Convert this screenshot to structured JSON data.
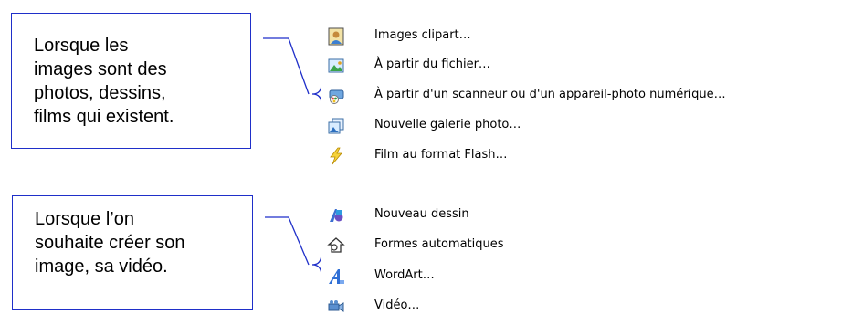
{
  "callouts": {
    "first": [
      "Lorsque les",
      "images sont des",
      "photos, dessins,",
      "films qui existent."
    ],
    "second": [
      "Lorsque l’on",
      "souhaite créer son",
      "image, sa vidéo."
    ]
  },
  "menu": {
    "group1": [
      {
        "label": "Images clipart…",
        "icon": "clipart-icon"
      },
      {
        "label": "À partir du fichier…",
        "icon": "picture-from-file-icon"
      },
      {
        "label": "À partir d'un scanneur ou d'un appareil-photo numérique…",
        "icon": "scanner-camera-icon"
      },
      {
        "label": "Nouvelle galerie photo…",
        "icon": "photo-album-icon"
      },
      {
        "label": "Film au format Flash…",
        "icon": "flash-lightning-icon"
      }
    ],
    "group2": [
      {
        "label": "Nouveau dessin",
        "icon": "new-drawing-icon"
      },
      {
        "label": "Formes automatiques",
        "icon": "autoshapes-icon"
      },
      {
        "label": "WordArt…",
        "icon": "wordart-icon"
      },
      {
        "label": "Vidéo…",
        "icon": "video-camera-icon"
      }
    ]
  },
  "colors": {
    "callout_border": "#1f2fc9",
    "separator": "#a6a6a6"
  }
}
